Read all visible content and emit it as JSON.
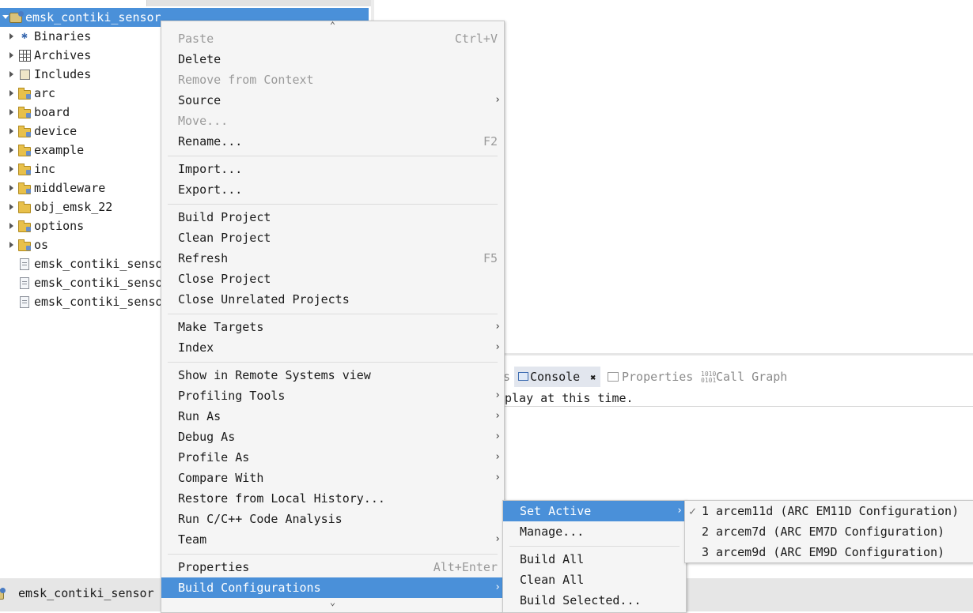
{
  "explorer": {
    "project": "emsk_contiki_sensor",
    "items": [
      {
        "label": "Binaries",
        "icon": "binaries-icon"
      },
      {
        "label": "Archives",
        "icon": "archives-icon"
      },
      {
        "label": "Includes",
        "icon": "includes-icon"
      },
      {
        "label": "arc",
        "icon": "source-folder-icon"
      },
      {
        "label": "board",
        "icon": "source-folder-icon"
      },
      {
        "label": "device",
        "icon": "source-folder-icon"
      },
      {
        "label": "example",
        "icon": "source-folder-icon"
      },
      {
        "label": "inc",
        "icon": "source-folder-icon"
      },
      {
        "label": "middleware",
        "icon": "source-folder-icon"
      },
      {
        "label": "obj_emsk_22",
        "icon": "folder-icon"
      },
      {
        "label": "options",
        "icon": "source-folder-icon"
      },
      {
        "label": "os",
        "icon": "source-folder-icon"
      },
      {
        "label": "emsk_contiki_senso",
        "icon": "file-icon"
      },
      {
        "label": "emsk_contiki_senso",
        "icon": "file-icon"
      },
      {
        "label": "emsk_contiki_senso",
        "icon": "file-icon"
      }
    ]
  },
  "context_menu": {
    "scroll_up": "⌃",
    "scroll_down": "⌄",
    "paste": {
      "label": "Paste",
      "shortcut": "Ctrl+V"
    },
    "delete": "Delete",
    "remove_context": "Remove from Context",
    "source": "Source",
    "move": "Move...",
    "rename": {
      "label": "Rename...",
      "shortcut": "F2"
    },
    "import": "Import...",
    "export": "Export...",
    "build_project": "Build Project",
    "clean_project": "Clean Project",
    "refresh": {
      "label": "Refresh",
      "shortcut": "F5"
    },
    "close_project": "Close Project",
    "close_unrelated": "Close Unrelated Projects",
    "make_targets": "Make Targets",
    "index": "Index",
    "show_remote": "Show in Remote Systems view",
    "profiling_tools": "Profiling Tools",
    "run_as": "Run As",
    "debug_as": "Debug As",
    "profile_as": "Profile As",
    "compare_with": "Compare With",
    "restore_history": "Restore from Local History...",
    "run_analysis": "Run C/C++ Code Analysis",
    "team": "Team",
    "properties": {
      "label": "Properties",
      "shortcut": "Alt+Enter"
    },
    "build_configurations": "Build Configurations"
  },
  "build_config_menu": {
    "set_active": "Set Active",
    "manage": "Manage...",
    "build_all": "Build All",
    "clean_all": "Clean All",
    "build_selected": "Build Selected..."
  },
  "set_active_menu": {
    "check": "✓",
    "items": [
      "1 arcem11d (ARC EM11D Configuration)",
      "2 arcem7d (ARC EM7D Configuration)",
      "3 arcem9d (ARC EM9D Configuration)"
    ]
  },
  "bottom_panel": {
    "tab_partial": "s",
    "console": "Console",
    "properties": "Properties",
    "call_graph": "Call Graph",
    "message": "play at this time."
  },
  "status": {
    "project": "emsk_contiki_sensor"
  },
  "colors": {
    "selection": "#4a90d9",
    "menu_bg": "#f5f5f5"
  }
}
